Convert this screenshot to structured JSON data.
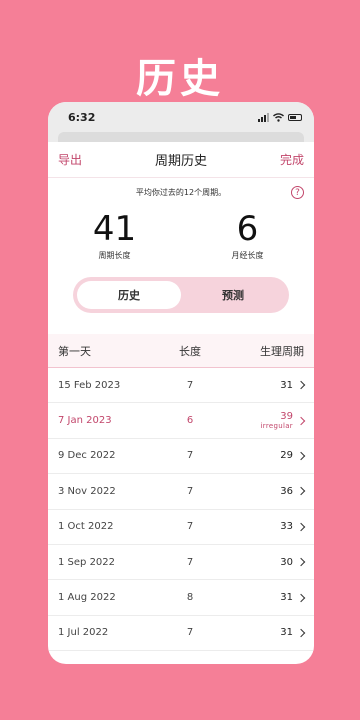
{
  "hero": {
    "title": "历史"
  },
  "status_bar": {
    "time": "6:32"
  },
  "nav": {
    "left": "导出",
    "title": "周期历史",
    "right": "完成"
  },
  "summary": {
    "subtitle": "平均你过去的12个周期。",
    "cycle_length": {
      "value": "41",
      "label": "周期长度"
    },
    "period_length": {
      "value": "6",
      "label": "月经长度"
    }
  },
  "tabs": [
    {
      "label": "历史",
      "active": true
    },
    {
      "label": "预测",
      "active": false
    }
  ],
  "table": {
    "headers": {
      "first_day": "第一天",
      "length": "长度",
      "cycle": "生理周期"
    },
    "rows": [
      {
        "date": "15 Feb 2023",
        "length": "7",
        "cycle": "31",
        "note": ""
      },
      {
        "date": "7 Jan 2023",
        "length": "6",
        "cycle": "39",
        "note": "irregular"
      },
      {
        "date": "9 Dec 2022",
        "length": "7",
        "cycle": "29",
        "note": ""
      },
      {
        "date": "3 Nov 2022",
        "length": "7",
        "cycle": "36",
        "note": ""
      },
      {
        "date": "1 Oct 2022",
        "length": "7",
        "cycle": "33",
        "note": ""
      },
      {
        "date": "1 Sep 2022",
        "length": "7",
        "cycle": "30",
        "note": ""
      },
      {
        "date": "1 Aug 2022",
        "length": "8",
        "cycle": "31",
        "note": ""
      },
      {
        "date": "1 Jul 2022",
        "length": "7",
        "cycle": "31",
        "note": ""
      }
    ]
  },
  "colors": {
    "background": "#f57f97",
    "accent": "#c2466b",
    "segment_bg": "#f6d3dc"
  }
}
